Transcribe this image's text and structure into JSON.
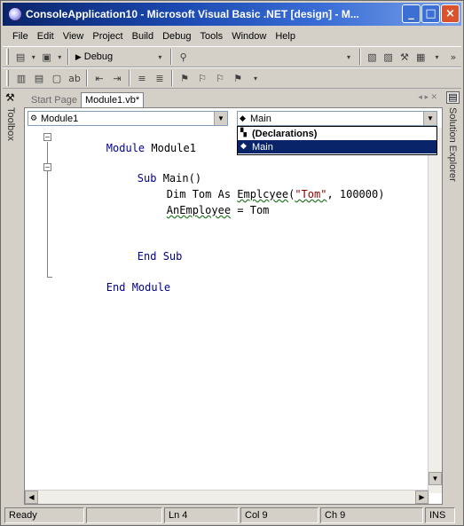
{
  "window": {
    "title": "ConsoleApplication10 - Microsoft Visual Basic .NET [design] - M...",
    "min_label": "_",
    "max_label": "□",
    "close_label": "×"
  },
  "menu": [
    "File",
    "Edit",
    "View",
    "Project",
    "Build",
    "Debug",
    "Tools",
    "Window",
    "Help"
  ],
  "toolbar": {
    "configuration": "Debug"
  },
  "toolbox": {
    "label": "Toolbox"
  },
  "solution_explorer": {
    "label": "Solution Explorer"
  },
  "tabs": [
    {
      "label": "Start Page",
      "active": false
    },
    {
      "label": "Module1.vb*",
      "active": true
    }
  ],
  "editor": {
    "class_combo": "Module1",
    "method_combo": "Main",
    "method_options": [
      {
        "label": "(Declarations)",
        "selected": false
      },
      {
        "label": "Main",
        "selected": true
      }
    ],
    "code": {
      "l1_kw": "Module",
      "l1_name": " Module1",
      "l2_kw": "Sub",
      "l2_name": " Main()",
      "l3_a": "Dim Tom As ",
      "l3_err": "Emplcyee",
      "l3_b": "(",
      "l3_str": "\"Tom\"",
      "l3_c": ", 100000)",
      "l4_err": "AnEmployee",
      "l4_b": " = Tom",
      "l5": "End Sub",
      "l6": "End Module"
    }
  },
  "status": {
    "state": "Ready",
    "line": "Ln 4",
    "col": "Col 9",
    "ch": "Ch 9",
    "mode": "INS"
  }
}
